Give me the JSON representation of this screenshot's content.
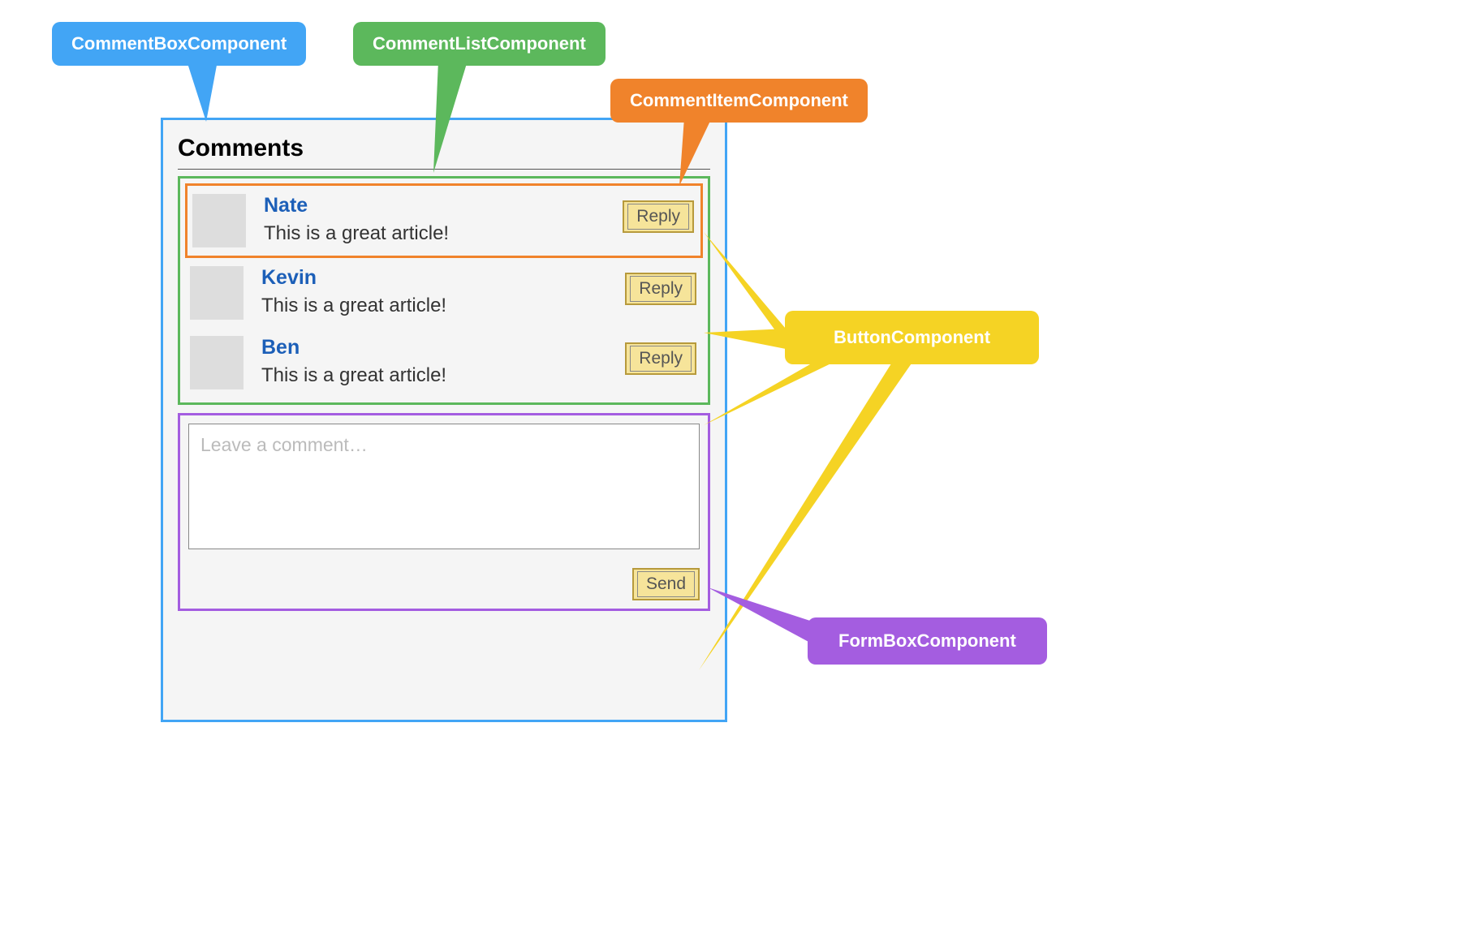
{
  "callouts": {
    "comment_box": "CommentBoxComponent",
    "comment_list": "CommentListComponent",
    "comment_item": "CommentItemComponent",
    "button": "ButtonComponent",
    "form_box": "FormBoxComponent"
  },
  "panel": {
    "title": "Comments"
  },
  "comments": [
    {
      "author": "Nate",
      "text": "This is a great article!",
      "reply_label": "Reply"
    },
    {
      "author": "Kevin",
      "text": "This is a great article!",
      "reply_label": "Reply"
    },
    {
      "author": "Ben",
      "text": "This is a great article!",
      "reply_label": "Reply"
    }
  ],
  "form": {
    "placeholder": "Leave a comment…",
    "send_label": "Send"
  },
  "colors": {
    "blue": "#42a5f5",
    "green": "#5cb85c",
    "orange": "#f0832b",
    "yellow": "#f5d324",
    "purple": "#a45de0",
    "btn_bg": "#f6e49a",
    "btn_border": "#b79a3c",
    "author": "#1c5fb8"
  }
}
